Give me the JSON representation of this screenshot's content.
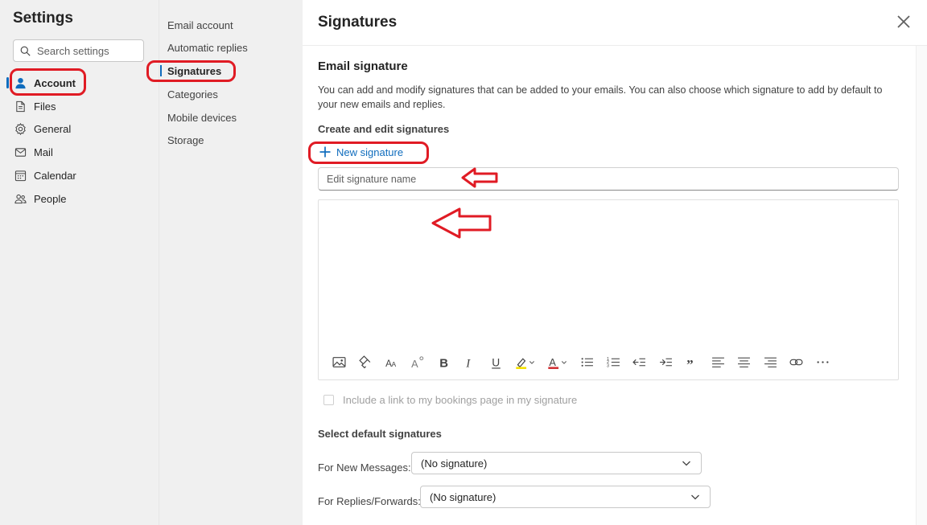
{
  "left": {
    "title": "Settings",
    "search_placeholder": "Search settings",
    "items": [
      {
        "label": "Account",
        "icon": "person-icon"
      },
      {
        "label": "Files",
        "icon": "file-icon"
      },
      {
        "label": "General",
        "icon": "gear-icon"
      },
      {
        "label": "Mail",
        "icon": "mail-icon"
      },
      {
        "label": "Calendar",
        "icon": "calendar-icon"
      },
      {
        "label": "People",
        "icon": "people-icon"
      }
    ],
    "active": "Account"
  },
  "middle": {
    "items": [
      "Email account",
      "Automatic replies",
      "Signatures",
      "Categories",
      "Mobile devices",
      "Storage"
    ],
    "active": "Signatures"
  },
  "panel": {
    "title": "Signatures",
    "section_title": "Email signature",
    "description": "You can add and modify signatures that can be added to your emails. You can also choose which signature to add by default to your new emails and replies.",
    "create_label": "Create and edit signatures",
    "new_signature": "New signature",
    "name_placeholder": "Edit signature name",
    "bookings_label": "Include a link to my bookings page in my signature",
    "default_title": "Select default signatures",
    "new_messages_label": "For New Messages:",
    "new_messages_value": "(No signature)",
    "replies_label": "For Replies/Forwards:",
    "replies_value": "(No signature)"
  },
  "toolbar": [
    "insert-picture-icon",
    "format-painter-icon",
    "font-size-icon",
    "text-effects-icon",
    "bold-icon",
    "italic-icon",
    "underline-icon",
    "highlight-icon",
    "font-color-icon",
    "bullets-icon",
    "numbering-icon",
    "decrease-indent-icon",
    "increase-indent-icon",
    "quote-icon",
    "align-left-icon",
    "align-center-icon",
    "align-right-icon",
    "link-icon",
    "more-icon"
  ],
  "colors": {
    "accent": "#0f6cbd",
    "annotation": "#e01b24",
    "highlight": "#f5e100",
    "font_color": "#d13438"
  }
}
